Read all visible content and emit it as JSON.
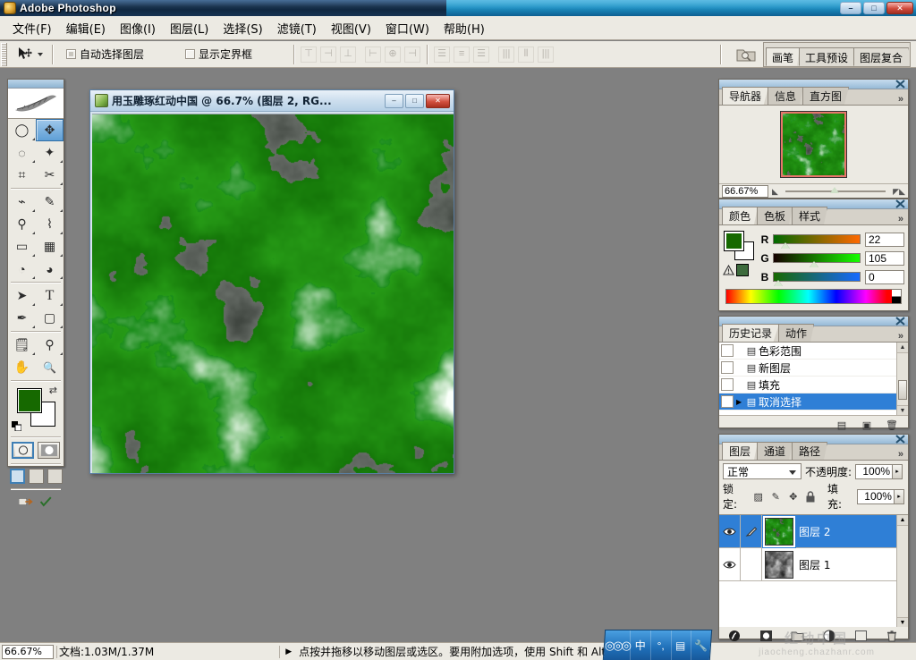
{
  "app": {
    "title": "Adobe Photoshop",
    "icon": "photoshop-feather-icon",
    "window_buttons": {
      "minimize": "–",
      "maximize": "□",
      "close": "✕"
    }
  },
  "menubar": {
    "items": [
      {
        "label": "文件(F)"
      },
      {
        "label": "编辑(E)"
      },
      {
        "label": "图像(I)"
      },
      {
        "label": "图层(L)"
      },
      {
        "label": "选择(S)"
      },
      {
        "label": "滤镜(T)"
      },
      {
        "label": "视图(V)"
      },
      {
        "label": "窗口(W)"
      },
      {
        "label": "帮助(H)"
      }
    ]
  },
  "options_bar": {
    "tool_preset_icon": "move-tool-icon",
    "dropdown_icon": "chevron-down-icon",
    "auto_select_layer": {
      "label": "自动选择图层",
      "checked": false
    },
    "show_bounding_box": {
      "label": "显示定界框",
      "checked": false
    },
    "align_buttons": [
      {
        "name": "align-top-edges",
        "glyph": "⊤"
      },
      {
        "name": "align-vertical-centers",
        "glyph": "⊣"
      },
      {
        "name": "align-bottom-edges",
        "glyph": "⊥"
      },
      {
        "name": "align-left-edges",
        "glyph": "⊢"
      },
      {
        "name": "align-horizontal-centers",
        "glyph": "⊕"
      },
      {
        "name": "align-right-edges",
        "glyph": "⊣"
      }
    ],
    "distribute_buttons": [
      {
        "name": "distribute-top-edges",
        "glyph": "☰"
      },
      {
        "name": "distribute-vertical-centers",
        "glyph": "≡"
      },
      {
        "name": "distribute-bottom-edges",
        "glyph": "☰"
      },
      {
        "name": "distribute-left-edges",
        "glyph": "|||"
      },
      {
        "name": "distribute-horizontal-centers",
        "glyph": "⦀"
      },
      {
        "name": "distribute-right-edges",
        "glyph": "|||"
      }
    ],
    "file_browser_icon": "file-browser-icon",
    "palette_well_tabs": [
      {
        "label": "画笔"
      },
      {
        "label": "工具预设"
      },
      {
        "label": "图层复合"
      }
    ]
  },
  "toolbox": {
    "logo_icon": "photoshop-feather-logo",
    "tools": [
      {
        "name": "marquee-tool",
        "glyph": "◯",
        "selected": false,
        "has_submenu": true
      },
      {
        "name": "move-tool",
        "glyph": "✥",
        "selected": true,
        "has_submenu": false
      },
      {
        "name": "lasso-tool",
        "glyph": "◌",
        "selected": false,
        "has_submenu": true
      },
      {
        "name": "magic-wand-tool",
        "glyph": "✦",
        "selected": false,
        "has_submenu": true
      },
      {
        "name": "crop-tool",
        "glyph": "⌗",
        "selected": false,
        "has_submenu": false
      },
      {
        "name": "slice-tool",
        "glyph": "✂",
        "selected": false,
        "has_submenu": true
      },
      {
        "name": "healing-brush-tool",
        "glyph": "⌁",
        "selected": false,
        "has_submenu": true
      },
      {
        "name": "brush-tool",
        "glyph": "✎",
        "selected": false,
        "has_submenu": true
      },
      {
        "name": "clone-stamp-tool",
        "glyph": "⚲",
        "selected": false,
        "has_submenu": true
      },
      {
        "name": "history-brush-tool",
        "glyph": "⌇",
        "selected": false,
        "has_submenu": true
      },
      {
        "name": "eraser-tool",
        "glyph": "▭",
        "selected": false,
        "has_submenu": true
      },
      {
        "name": "gradient-tool",
        "glyph": "▦",
        "selected": false,
        "has_submenu": true
      },
      {
        "name": "blur-tool",
        "glyph": "◔",
        "selected": false,
        "has_submenu": true
      },
      {
        "name": "dodge-tool",
        "glyph": "◕",
        "selected": false,
        "has_submenu": true
      },
      {
        "name": "path-selection-tool",
        "glyph": "➤",
        "selected": false,
        "has_submenu": true
      },
      {
        "name": "type-tool",
        "glyph": "T",
        "selected": false,
        "has_submenu": true
      },
      {
        "name": "pen-tool",
        "glyph": "✒",
        "selected": false,
        "has_submenu": true
      },
      {
        "name": "rectangle-shape-tool",
        "glyph": "▢",
        "selected": false,
        "has_submenu": true
      },
      {
        "name": "notes-tool",
        "glyph": "🗒",
        "selected": false,
        "has_submenu": true
      },
      {
        "name": "eyedropper-tool",
        "glyph": "⚲",
        "selected": false,
        "has_submenu": true
      },
      {
        "name": "hand-tool",
        "glyph": "✋",
        "selected": false,
        "has_submenu": false
      },
      {
        "name": "zoom-tool",
        "glyph": "🔍",
        "selected": false,
        "has_submenu": false
      }
    ],
    "foreground_color": "#166900",
    "background_color": "#ffffff",
    "swap_icon": "swap-colors-icon",
    "default_colors_icon": "default-colors-icon",
    "quick_mask": [
      {
        "name": "standard-mode-button",
        "selected": true
      },
      {
        "name": "quick-mask-mode-button",
        "selected": false
      }
    ],
    "screen_modes": [
      {
        "name": "standard-screen-mode",
        "selected": true
      },
      {
        "name": "full-screen-with-menubar",
        "selected": false
      },
      {
        "name": "full-screen-mode",
        "selected": false
      }
    ],
    "jump_to_imageready_icon": "jump-to-imageready-icon",
    "edit_in_imageready_icon": "edit-in-imageready-icon"
  },
  "document": {
    "title": "用玉雕琢红动中国 @ 66.7% (图层 2, RG...",
    "icon": "document-icon",
    "buttons": {
      "minimize": "–",
      "maximize": "□",
      "close": "✕"
    }
  },
  "navigator": {
    "tabs": [
      {
        "label": "导航器",
        "active": true
      },
      {
        "label": "信息",
        "active": false
      },
      {
        "label": "直方图",
        "active": false
      }
    ],
    "more_icon": "palette-menu-icon",
    "close_icon": "close-icon",
    "zoom_value": "66.67%",
    "zoom_out_icon": "zoom-out-icon",
    "zoom_in_icon": "zoom-in-icon"
  },
  "color": {
    "tabs": [
      {
        "label": "颜色",
        "active": true
      },
      {
        "label": "色板",
        "active": false
      },
      {
        "label": "样式",
        "active": false
      }
    ],
    "more_icon": "palette-menu-icon",
    "close_icon": "close-icon",
    "channels": [
      {
        "label": "R",
        "value": "22"
      },
      {
        "label": "G",
        "value": "105"
      },
      {
        "label": "B",
        "value": "0"
      }
    ],
    "warning_icon": "out-of-gamut-warning-icon",
    "foreground_color": "#166900",
    "background_color": "#ffffff"
  },
  "history": {
    "tabs": [
      {
        "label": "历史记录",
        "active": true
      },
      {
        "label": "动作",
        "active": false
      }
    ],
    "more_icon": "palette-menu-icon",
    "close_icon": "close-icon",
    "items": [
      {
        "label": "色彩范围",
        "selected": false,
        "icon": "history-state-icon"
      },
      {
        "label": "新图层",
        "selected": false,
        "icon": "history-state-icon"
      },
      {
        "label": "填充",
        "selected": false,
        "icon": "history-fill-icon"
      },
      {
        "label": "取消选择",
        "selected": true,
        "icon": "history-state-icon"
      }
    ],
    "footer_buttons": [
      {
        "name": "create-document-from-state-button",
        "glyph": "▤"
      },
      {
        "name": "create-new-snapshot-button",
        "glyph": "▣"
      },
      {
        "name": "delete-state-button",
        "glyph": "🗑"
      }
    ]
  },
  "layers": {
    "tabs": [
      {
        "label": "图层",
        "active": true
      },
      {
        "label": "通道",
        "active": false
      },
      {
        "label": "路径",
        "active": false
      }
    ],
    "more_icon": "palette-menu-icon",
    "close_icon": "close-icon",
    "blend_mode": "正常",
    "opacity_label": "不透明度:",
    "opacity_value": "100%",
    "lock_label": "锁定:",
    "lock_icons": [
      {
        "name": "lock-transparent-pixels-icon",
        "glyph": "▨"
      },
      {
        "name": "lock-image-pixels-icon",
        "glyph": "✎"
      },
      {
        "name": "lock-position-icon",
        "glyph": "✥"
      },
      {
        "name": "lock-all-icon",
        "glyph": "🔒"
      }
    ],
    "fill_label": "填充:",
    "fill_value": "100%",
    "rows": [
      {
        "name": "图层 2",
        "selected": true,
        "visible": true,
        "has_brush_icon": true,
        "thumb": "green-jade"
      },
      {
        "name": "图层 1",
        "selected": false,
        "visible": true,
        "has_brush_icon": false,
        "thumb": "gray-clouds"
      }
    ],
    "footer_buttons": [
      {
        "name": "layer-style-button",
        "glyph": "ƒ"
      },
      {
        "name": "add-layer-mask-button",
        "glyph": "◉"
      },
      {
        "name": "new-group-button",
        "glyph": "▭"
      },
      {
        "name": "new-adjustment-layer-button",
        "glyph": "◐"
      },
      {
        "name": "new-layer-button",
        "glyph": "▣"
      },
      {
        "name": "delete-layer-button",
        "glyph": "🗑"
      }
    ]
  },
  "statusbar": {
    "zoom": "66.67%",
    "doc_info": "文档:1.03M/1.37M",
    "arrow_icon": "status-arrow-icon",
    "hint": "点按并拖移以移动图层或选区。要用附加选项，使用 Shift 和 Alt 键。"
  },
  "taskbar": {
    "ime_cells": [
      {
        "name": "ime-logo",
        "label": "◎◎◎"
      },
      {
        "name": "ime-chinese-mode",
        "label": "中"
      },
      {
        "name": "ime-punctuation",
        "label": "°,"
      },
      {
        "name": "ime-soft-keyboard",
        "label": "▤"
      },
      {
        "name": "ime-toolbox",
        "label": "🔧"
      }
    ]
  },
  "watermark": {
    "line1": "红动中国",
    "line2": "jiaocheng.chazhanr.com"
  }
}
